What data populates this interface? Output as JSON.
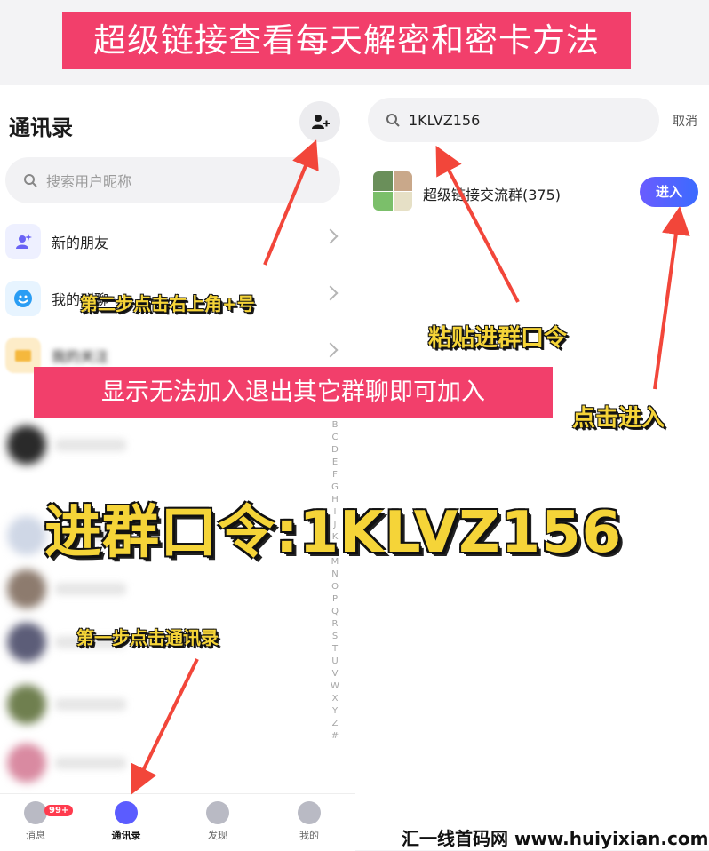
{
  "top_banner": "超级链接查看每天解密和密卡方法",
  "contacts": {
    "title": "通讯录",
    "add_icon": "add-friend-icon",
    "search_placeholder": "搜索用户昵称",
    "items": [
      {
        "label": "新的朋友",
        "icon": "new-friend-icon"
      },
      {
        "label": "我的群聊",
        "icon": "smile-icon"
      },
      {
        "label": "我的关注",
        "icon": "folder-icon"
      }
    ],
    "alpha_index": [
      "B",
      "C",
      "D",
      "E",
      "F",
      "G",
      "H",
      "I",
      "J",
      "K",
      "L",
      "M",
      "N",
      "O",
      "P",
      "Q",
      "R",
      "S",
      "T",
      "U",
      "V",
      "W",
      "X",
      "Y",
      "Z",
      "#"
    ]
  },
  "search": {
    "value": "1KLVZ156",
    "cancel": "取消",
    "result": {
      "name": "超级链接交流群(375)",
      "join": "进入"
    }
  },
  "bottom_nav": {
    "items": [
      {
        "label": "消息",
        "badge": "99+"
      },
      {
        "label": "通讯录"
      },
      {
        "label": "发现"
      },
      {
        "label": "我的"
      }
    ]
  },
  "annotations": {
    "step2": "第二步点击右上角+号",
    "paste": "粘贴进群口令",
    "click_join": "点击进入",
    "mid_banner": "显示无法加入退出其它群聊即可加入",
    "passcode": "进群口令:1KLVZ156",
    "step1": "第一步点击通讯录"
  },
  "watermark": "汇一线首码网 www.huiyixian.com",
  "colors": {
    "banner": "#f23f6b",
    "accent": "#5b5cff",
    "callout": "#f5d438",
    "arrow": "#f2463a"
  }
}
